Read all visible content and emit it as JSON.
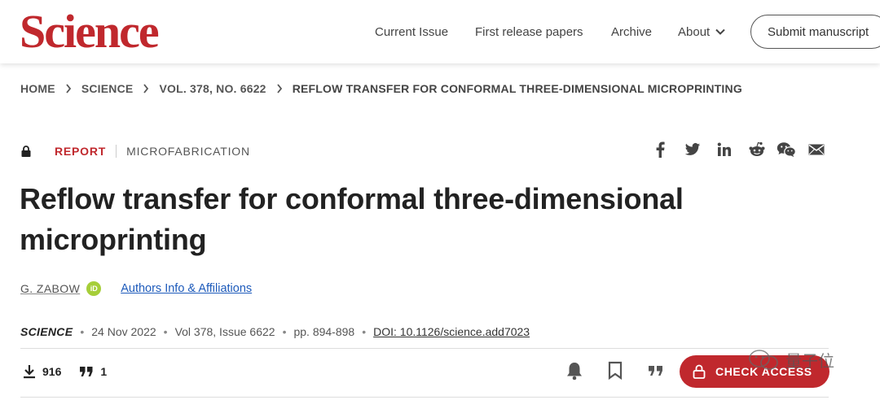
{
  "header": {
    "logo": "Science",
    "nav": [
      {
        "label": "Current Issue"
      },
      {
        "label": "First release papers"
      },
      {
        "label": "Archive"
      },
      {
        "label": "About"
      }
    ],
    "submit_label": "Submit manuscript"
  },
  "breadcrumb": [
    "HOME",
    "SCIENCE",
    "VOL. 378, NO. 6622",
    "REFLOW TRANSFER FOR CONFORMAL THREE-DIMENSIONAL MICROPRINTING"
  ],
  "article": {
    "type_label": "REPORT",
    "subject": "MICROFABRICATION",
    "title": "Reflow transfer for conformal three-dimensional microprinting",
    "author": "G. ZABOW",
    "orcid_badge": "iD",
    "affiliations_link": "Authors Info & Affiliations",
    "journal": "SCIENCE",
    "date": "24 Nov 2022",
    "volume": "Vol 378, Issue 6622",
    "pages": "pp. 894-898",
    "doi": "DOI: 10.1126/science.add7023",
    "downloads": "916",
    "citations": "1",
    "check_access_label": "CHECK ACCESS"
  },
  "share_icons": [
    "facebook-icon",
    "twitter-icon",
    "linkedin-icon",
    "reddit-icon",
    "wechat-icon",
    "email-icon"
  ],
  "watermark": "量子位",
  "colors": {
    "brand_red": "#c0282d",
    "link_blue": "#1e5bbb"
  }
}
